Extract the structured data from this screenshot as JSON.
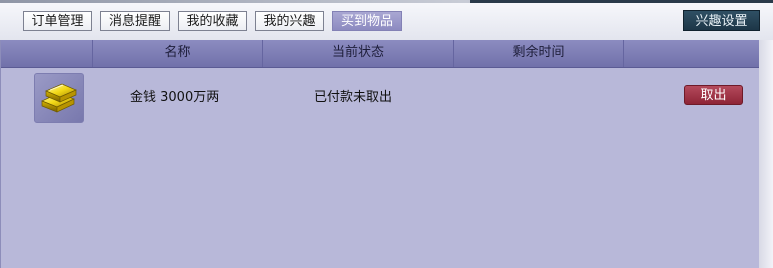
{
  "tabs": [
    {
      "label": "订单管理",
      "active": false
    },
    {
      "label": "消息提醒",
      "active": false
    },
    {
      "label": "我的收藏",
      "active": false
    },
    {
      "label": "我的兴趣",
      "active": false
    },
    {
      "label": "买到物品",
      "active": true
    }
  ],
  "settings_button": "兴趣设置",
  "table": {
    "columns": [
      "名称",
      "当前状态",
      "剩余时间"
    ],
    "rows": [
      {
        "icon": "gold-bars-icon",
        "name": "金钱  3000万两",
        "status": "已付款未取出",
        "remaining": "",
        "action": "取出"
      }
    ]
  },
  "colors": {
    "active_tab": "#9795c9",
    "header": "#7f7fb6",
    "panel": "#b8b8d9",
    "settings_button": "#25414f",
    "takeout_button": "#a23a4c"
  }
}
